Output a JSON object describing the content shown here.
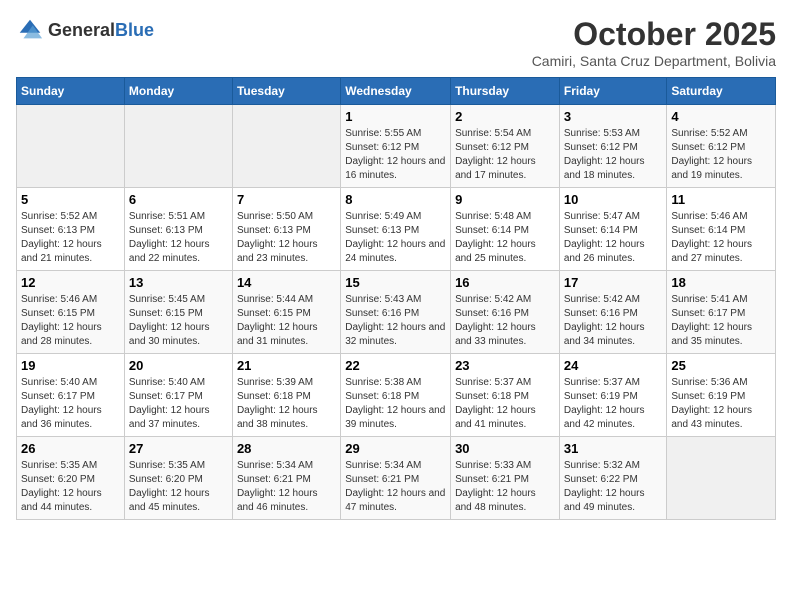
{
  "header": {
    "logo_general": "General",
    "logo_blue": "Blue",
    "month": "October 2025",
    "location": "Camiri, Santa Cruz Department, Bolivia"
  },
  "days_of_week": [
    "Sunday",
    "Monday",
    "Tuesday",
    "Wednesday",
    "Thursday",
    "Friday",
    "Saturday"
  ],
  "weeks": [
    [
      {
        "day": "",
        "sunrise": "",
        "sunset": "",
        "daylight": ""
      },
      {
        "day": "",
        "sunrise": "",
        "sunset": "",
        "daylight": ""
      },
      {
        "day": "",
        "sunrise": "",
        "sunset": "",
        "daylight": ""
      },
      {
        "day": "1",
        "sunrise": "Sunrise: 5:55 AM",
        "sunset": "Sunset: 6:12 PM",
        "daylight": "Daylight: 12 hours and 16 minutes."
      },
      {
        "day": "2",
        "sunrise": "Sunrise: 5:54 AM",
        "sunset": "Sunset: 6:12 PM",
        "daylight": "Daylight: 12 hours and 17 minutes."
      },
      {
        "day": "3",
        "sunrise": "Sunrise: 5:53 AM",
        "sunset": "Sunset: 6:12 PM",
        "daylight": "Daylight: 12 hours and 18 minutes."
      },
      {
        "day": "4",
        "sunrise": "Sunrise: 5:52 AM",
        "sunset": "Sunset: 6:12 PM",
        "daylight": "Daylight: 12 hours and 19 minutes."
      }
    ],
    [
      {
        "day": "5",
        "sunrise": "Sunrise: 5:52 AM",
        "sunset": "Sunset: 6:13 PM",
        "daylight": "Daylight: 12 hours and 21 minutes."
      },
      {
        "day": "6",
        "sunrise": "Sunrise: 5:51 AM",
        "sunset": "Sunset: 6:13 PM",
        "daylight": "Daylight: 12 hours and 22 minutes."
      },
      {
        "day": "7",
        "sunrise": "Sunrise: 5:50 AM",
        "sunset": "Sunset: 6:13 PM",
        "daylight": "Daylight: 12 hours and 23 minutes."
      },
      {
        "day": "8",
        "sunrise": "Sunrise: 5:49 AM",
        "sunset": "Sunset: 6:13 PM",
        "daylight": "Daylight: 12 hours and 24 minutes."
      },
      {
        "day": "9",
        "sunrise": "Sunrise: 5:48 AM",
        "sunset": "Sunset: 6:14 PM",
        "daylight": "Daylight: 12 hours and 25 minutes."
      },
      {
        "day": "10",
        "sunrise": "Sunrise: 5:47 AM",
        "sunset": "Sunset: 6:14 PM",
        "daylight": "Daylight: 12 hours and 26 minutes."
      },
      {
        "day": "11",
        "sunrise": "Sunrise: 5:46 AM",
        "sunset": "Sunset: 6:14 PM",
        "daylight": "Daylight: 12 hours and 27 minutes."
      }
    ],
    [
      {
        "day": "12",
        "sunrise": "Sunrise: 5:46 AM",
        "sunset": "Sunset: 6:15 PM",
        "daylight": "Daylight: 12 hours and 28 minutes."
      },
      {
        "day": "13",
        "sunrise": "Sunrise: 5:45 AM",
        "sunset": "Sunset: 6:15 PM",
        "daylight": "Daylight: 12 hours and 30 minutes."
      },
      {
        "day": "14",
        "sunrise": "Sunrise: 5:44 AM",
        "sunset": "Sunset: 6:15 PM",
        "daylight": "Daylight: 12 hours and 31 minutes."
      },
      {
        "day": "15",
        "sunrise": "Sunrise: 5:43 AM",
        "sunset": "Sunset: 6:16 PM",
        "daylight": "Daylight: 12 hours and 32 minutes."
      },
      {
        "day": "16",
        "sunrise": "Sunrise: 5:42 AM",
        "sunset": "Sunset: 6:16 PM",
        "daylight": "Daylight: 12 hours and 33 minutes."
      },
      {
        "day": "17",
        "sunrise": "Sunrise: 5:42 AM",
        "sunset": "Sunset: 6:16 PM",
        "daylight": "Daylight: 12 hours and 34 minutes."
      },
      {
        "day": "18",
        "sunrise": "Sunrise: 5:41 AM",
        "sunset": "Sunset: 6:17 PM",
        "daylight": "Daylight: 12 hours and 35 minutes."
      }
    ],
    [
      {
        "day": "19",
        "sunrise": "Sunrise: 5:40 AM",
        "sunset": "Sunset: 6:17 PM",
        "daylight": "Daylight: 12 hours and 36 minutes."
      },
      {
        "day": "20",
        "sunrise": "Sunrise: 5:40 AM",
        "sunset": "Sunset: 6:17 PM",
        "daylight": "Daylight: 12 hours and 37 minutes."
      },
      {
        "day": "21",
        "sunrise": "Sunrise: 5:39 AM",
        "sunset": "Sunset: 6:18 PM",
        "daylight": "Daylight: 12 hours and 38 minutes."
      },
      {
        "day": "22",
        "sunrise": "Sunrise: 5:38 AM",
        "sunset": "Sunset: 6:18 PM",
        "daylight": "Daylight: 12 hours and 39 minutes."
      },
      {
        "day": "23",
        "sunrise": "Sunrise: 5:37 AM",
        "sunset": "Sunset: 6:18 PM",
        "daylight": "Daylight: 12 hours and 41 minutes."
      },
      {
        "day": "24",
        "sunrise": "Sunrise: 5:37 AM",
        "sunset": "Sunset: 6:19 PM",
        "daylight": "Daylight: 12 hours and 42 minutes."
      },
      {
        "day": "25",
        "sunrise": "Sunrise: 5:36 AM",
        "sunset": "Sunset: 6:19 PM",
        "daylight": "Daylight: 12 hours and 43 minutes."
      }
    ],
    [
      {
        "day": "26",
        "sunrise": "Sunrise: 5:35 AM",
        "sunset": "Sunset: 6:20 PM",
        "daylight": "Daylight: 12 hours and 44 minutes."
      },
      {
        "day": "27",
        "sunrise": "Sunrise: 5:35 AM",
        "sunset": "Sunset: 6:20 PM",
        "daylight": "Daylight: 12 hours and 45 minutes."
      },
      {
        "day": "28",
        "sunrise": "Sunrise: 5:34 AM",
        "sunset": "Sunset: 6:21 PM",
        "daylight": "Daylight: 12 hours and 46 minutes."
      },
      {
        "day": "29",
        "sunrise": "Sunrise: 5:34 AM",
        "sunset": "Sunset: 6:21 PM",
        "daylight": "Daylight: 12 hours and 47 minutes."
      },
      {
        "day": "30",
        "sunrise": "Sunrise: 5:33 AM",
        "sunset": "Sunset: 6:21 PM",
        "daylight": "Daylight: 12 hours and 48 minutes."
      },
      {
        "day": "31",
        "sunrise": "Sunrise: 5:32 AM",
        "sunset": "Sunset: 6:22 PM",
        "daylight": "Daylight: 12 hours and 49 minutes."
      },
      {
        "day": "",
        "sunrise": "",
        "sunset": "",
        "daylight": ""
      }
    ]
  ]
}
